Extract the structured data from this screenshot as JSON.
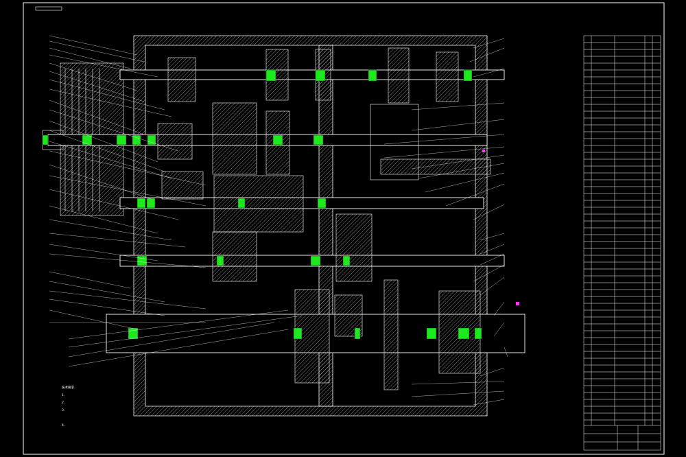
{
  "title": "",
  "colors": {
    "background": "#000000",
    "linework": "#ffffff",
    "bearing_highlight": "#1ee81e",
    "marker": "#ff33ff",
    "hatch": "#bfbfbf"
  },
  "notes_block": {
    "heading": "技术要求",
    "lines": [
      "1.",
      "2.",
      "3.",
      "4."
    ]
  }
}
